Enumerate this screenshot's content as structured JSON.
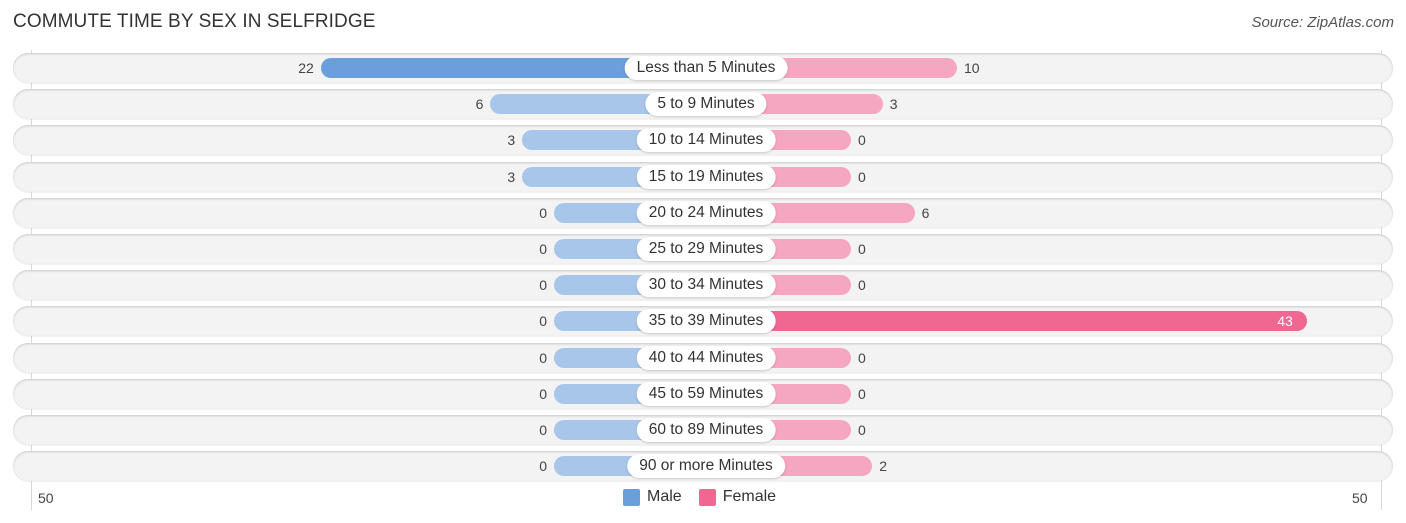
{
  "header": {
    "title": "COMMUTE TIME BY SEX IN SELFRIDGE",
    "source": "Source: ZipAtlas.com"
  },
  "colors": {
    "male": "#a7c6e9",
    "male_strong": "#6a9fdc",
    "female": "#f5a6c0",
    "female_strong": "#f06891"
  },
  "chart_data": {
    "type": "bar",
    "orientation": "horizontal-diverging",
    "title": "COMMUTE TIME BY SEX IN SELFRIDGE",
    "categories": [
      "Less than 5 Minutes",
      "5 to 9 Minutes",
      "10 to 14 Minutes",
      "15 to 19 Minutes",
      "20 to 24 Minutes",
      "25 to 29 Minutes",
      "30 to 34 Minutes",
      "35 to 39 Minutes",
      "40 to 44 Minutes",
      "45 to 59 Minutes",
      "60 to 89 Minutes",
      "90 or more Minutes"
    ],
    "series": [
      {
        "name": "Male",
        "values": [
          22,
          6,
          3,
          3,
          0,
          0,
          0,
          0,
          0,
          0,
          0,
          0
        ]
      },
      {
        "name": "Female",
        "values": [
          10,
          3,
          0,
          0,
          6,
          0,
          0,
          43,
          0,
          0,
          0,
          2
        ]
      }
    ],
    "axis": {
      "left_label": "50",
      "right_label": "50",
      "range": [
        50,
        50
      ]
    },
    "legend": {
      "entries": [
        "Male",
        "Female"
      ],
      "placement": "bottom-center"
    },
    "xlabel": "",
    "ylabel": ""
  }
}
